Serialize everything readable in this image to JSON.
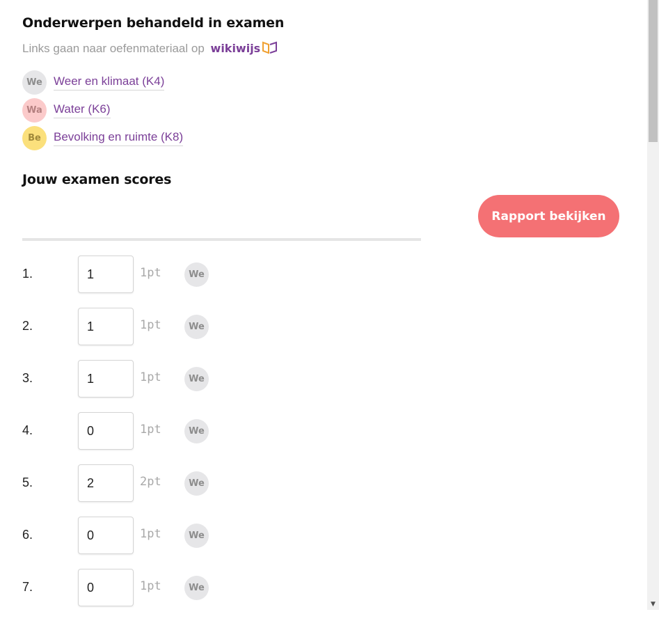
{
  "topics_section": {
    "heading": "Onderwerpen behandeld in examen",
    "subline_text": "Links gaan naar oefenmateriaal op",
    "wiki_link": "wikiwijs",
    "topics": [
      {
        "badge": "We",
        "label": "Weer en klimaat (K4)",
        "badge_bg": "#e6e6e8",
        "badge_fg": "#8d8d8d"
      },
      {
        "badge": "Wa",
        "label": "Water (K6)",
        "badge_bg": "#fbcaca",
        "badge_fg": "#b48080"
      },
      {
        "badge": "Be",
        "label": "Bevolking en ruimte (K8)",
        "badge_bg": "#fbe07c",
        "badge_fg": "#a0893a"
      }
    ]
  },
  "scores_section": {
    "heading": "Jouw examen scores",
    "report_button": "Rapport bekijken",
    "questions": [
      {
        "number": "1.",
        "value": "1",
        "points": "1pt",
        "topic": "We"
      },
      {
        "number": "2.",
        "value": "1",
        "points": "1pt",
        "topic": "We"
      },
      {
        "number": "3.",
        "value": "1",
        "points": "1pt",
        "topic": "We"
      },
      {
        "number": "4.",
        "value": "0",
        "points": "1pt",
        "topic": "We"
      },
      {
        "number": "5.",
        "value": "2",
        "points": "2pt",
        "topic": "We"
      },
      {
        "number": "6.",
        "value": "0",
        "points": "1pt",
        "topic": "We"
      },
      {
        "number": "7.",
        "value": "0",
        "points": "1pt",
        "topic": "We"
      }
    ]
  },
  "colors": {
    "link": "#7b3f98",
    "button": "#f47174",
    "wikiwijs_logo": "#f0a030"
  },
  "icons": {
    "wikiwijs_logo": "wikiwijs-logo-icon",
    "scroll_down": "scroll-down-arrow-icon"
  }
}
